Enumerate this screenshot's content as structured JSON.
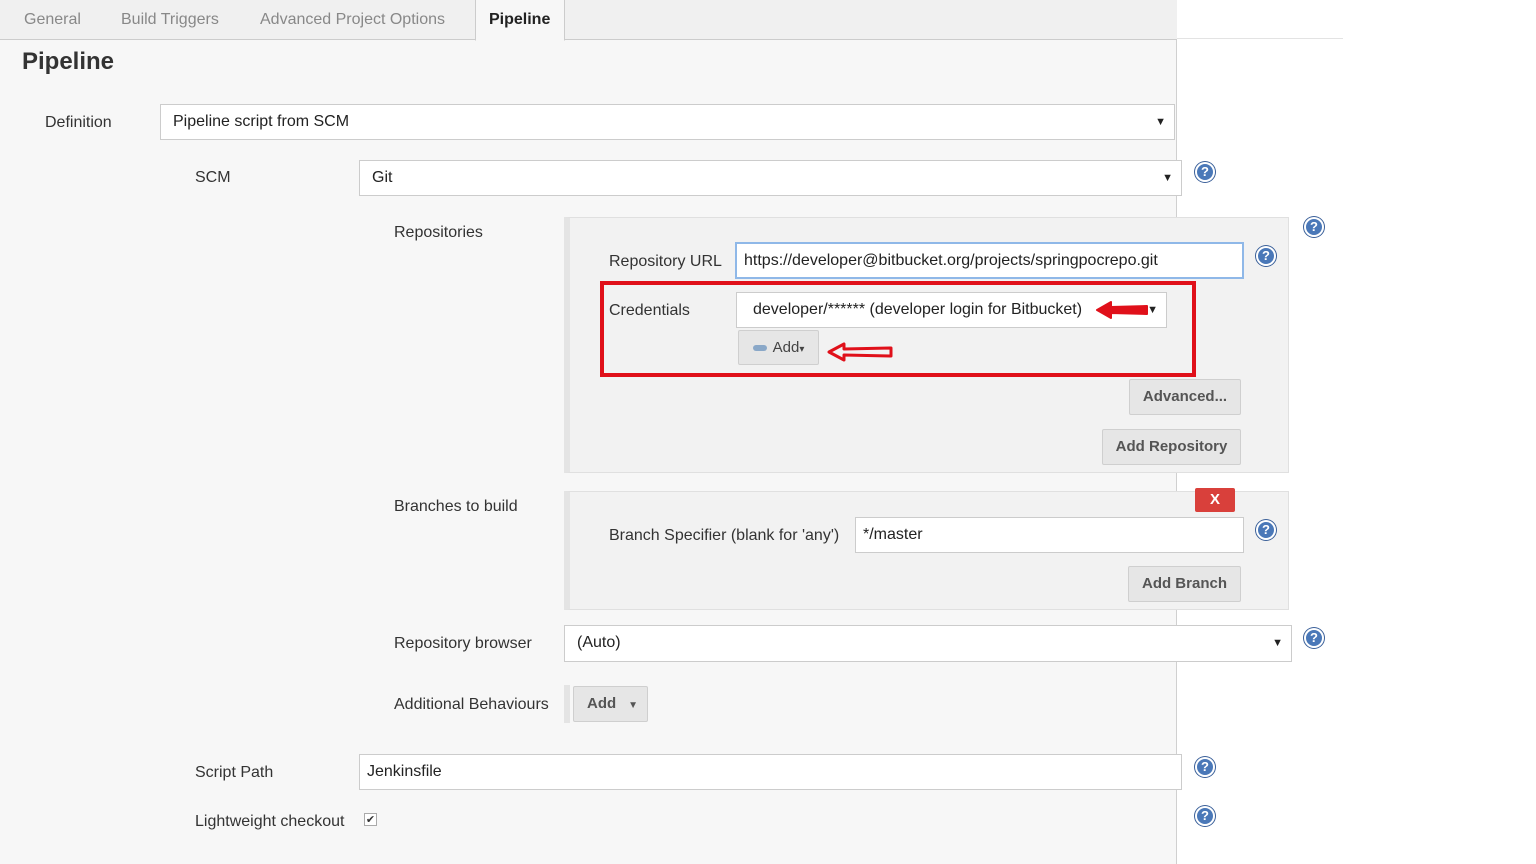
{
  "tabs": [
    "General",
    "Build Triggers",
    "Advanced Project Options",
    "Pipeline"
  ],
  "section_title": "Pipeline",
  "definition": {
    "label": "Definition",
    "value": "Pipeline script from SCM"
  },
  "scm": {
    "label": "SCM",
    "value": "Git"
  },
  "repositories": {
    "label": "Repositories",
    "url_label": "Repository URL",
    "url_value": "https://developer@bitbucket.org/projects/springpocrepo.git",
    "credentials_label": "Credentials",
    "credentials_value": "developer/****** (developer login for Bitbucket)",
    "add_label": "Add",
    "advanced_label": "Advanced...",
    "add_repository_label": "Add Repository"
  },
  "branches": {
    "label": "Branches to build",
    "delete_label": "X",
    "specifier_label": "Branch Specifier (blank for 'any')",
    "specifier_value": "*/master",
    "add_branch_label": "Add Branch"
  },
  "repo_browser": {
    "label": "Repository browser",
    "value": "(Auto)"
  },
  "additional": {
    "label": "Additional Behaviours",
    "add_label": "Add"
  },
  "script_path": {
    "label": "Script Path",
    "value": "Jenkinsfile"
  },
  "lightweight": {
    "label": "Lightweight checkout",
    "checked": true
  },
  "colors": {
    "annotation_red": "#e0101a",
    "help_blue": "#4a78b8",
    "delete_red": "#d9403b"
  }
}
